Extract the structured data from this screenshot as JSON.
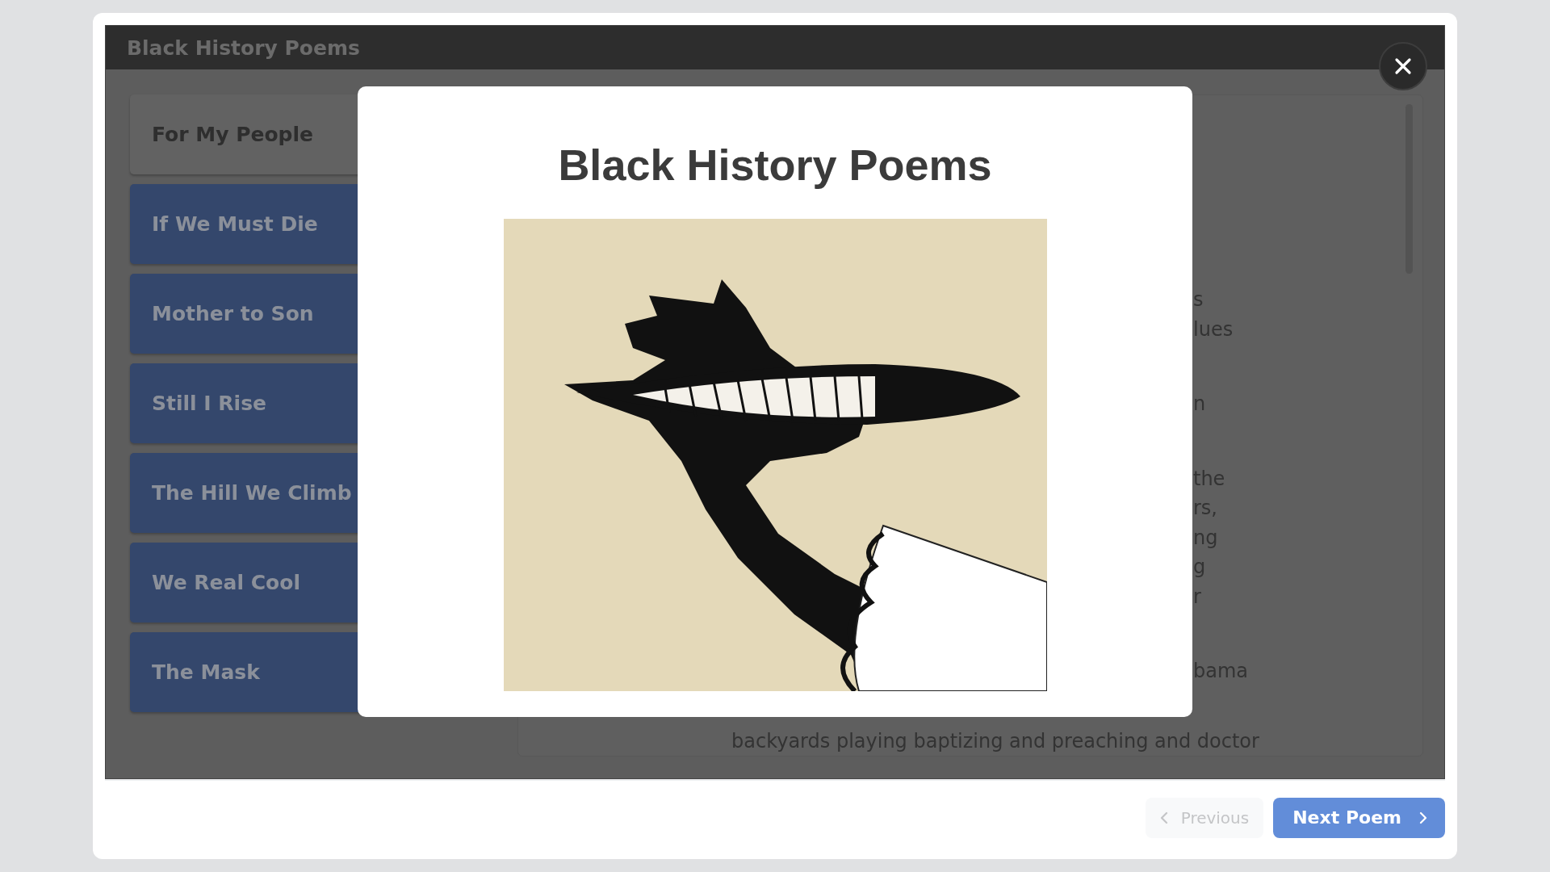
{
  "window": {
    "title": "Black History Poems"
  },
  "sidebar": {
    "items": [
      {
        "label": "For My People",
        "selected": true
      },
      {
        "label": "If We Must Die",
        "selected": false
      },
      {
        "label": "Mother to Son",
        "selected": false
      },
      {
        "label": "Still I Rise",
        "selected": false
      },
      {
        "label": "The Hill We Climb",
        "selected": false
      },
      {
        "label": "We Real Cool",
        "selected": false
      },
      {
        "label": "The Mask",
        "selected": false
      }
    ]
  },
  "poem": {
    "stanzas": [
      [
        "s",
        "lues"
      ],
      [
        "n"
      ],
      [
        "the",
        "rs,",
        "ng",
        "g",
        "r"
      ],
      [
        "bama"
      ]
    ],
    "last_line": "backyards playing baptizing and preaching and doctor"
  },
  "modal": {
    "title": "Black History Poems"
  },
  "footer": {
    "buttons": [
      {
        "label": "Previous",
        "kind": "previous",
        "disabled": true
      },
      {
        "label": "Next Poem",
        "kind": "next",
        "disabled": false
      }
    ]
  }
}
